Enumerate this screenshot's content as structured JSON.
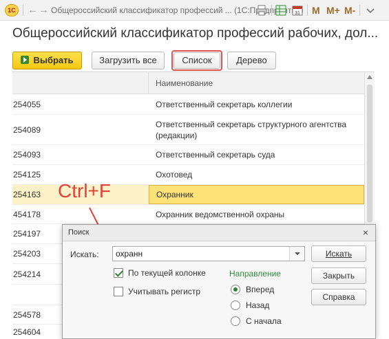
{
  "window": {
    "title": "Общероссийский классификатор профессий ... (1С:Предприятие)",
    "menu_letters": [
      "M",
      "M+",
      "M-"
    ]
  },
  "page": {
    "title": "Общероссийский классификатор профессий рабочих, дол..."
  },
  "toolbar": {
    "select_label": "Выбрать",
    "load_all_label": "Загрузить все",
    "list_label": "Список",
    "tree_label": "Дерево"
  },
  "table": {
    "column_name_header": "Наименование",
    "rows": [
      {
        "code": "254055",
        "name": "Ответственный секретарь коллегии"
      },
      {
        "code": "254089",
        "name": "Ответственный секретарь структурного агентства (редакции)"
      },
      {
        "code": "254093",
        "name": "Ответственный секретарь суда"
      },
      {
        "code": "254125",
        "name": "Охотовед"
      },
      {
        "code": "254163",
        "name": "Охранник"
      },
      {
        "code": "454178",
        "name": "Охранник ведомственной охраны"
      },
      {
        "code": "254197",
        "name": ""
      },
      {
        "code": "254203",
        "name": ""
      },
      {
        "code": "254214",
        "name": ""
      },
      {
        "code": "",
        "name": ""
      },
      {
        "code": "254578",
        "name": ""
      },
      {
        "code": "254604",
        "name": ""
      }
    ],
    "selected_index": 4
  },
  "annotation": {
    "shortcut": "Ctrl+F",
    "color": "#e0413d"
  },
  "search_dialog": {
    "title": "Поиск",
    "search_label": "Искать:",
    "search_value": "охранн",
    "find_button": "Искать",
    "close_button": "Закрыть",
    "help_button": "Справка",
    "current_column_label": "По текущей колонке",
    "current_column_checked": true,
    "match_case_label": "Учитывать регистр",
    "match_case_checked": false,
    "direction_title": "Направление",
    "direction_options": [
      "Вперед",
      "Назад",
      "С начала"
    ],
    "direction_selected": 0
  },
  "colors": {
    "primary_button": "#f5c711",
    "selected_row": "#fde27a",
    "highlight_frame": "#e05252",
    "direction_title": "#2e8b3d"
  }
}
